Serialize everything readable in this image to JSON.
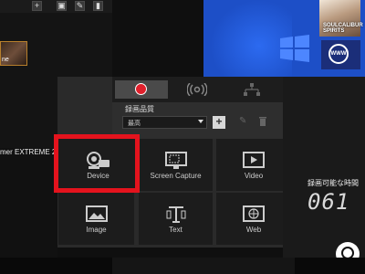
{
  "toolbar": {
    "add_label": "+",
    "icons": [
      "add-icon",
      "save-icon",
      "edit-icon",
      "delete-icon"
    ]
  },
  "source_panel": {
    "thumbnail_caption": "ne",
    "device_name_fragment": "mer EXTREME 2"
  },
  "preview": {
    "thumb1_text": "SOULCALIBUR SPIRITS",
    "thumb2_text": "WWW"
  },
  "record_panel": {
    "tabs": [
      {
        "name": "record",
        "icon": "record-icon"
      },
      {
        "name": "stream",
        "icon": "broadcast-icon"
      },
      {
        "name": "network",
        "icon": "network-icon"
      }
    ],
    "quality_label": "録画品質",
    "quality_value": "最高",
    "add_label": "+",
    "edit_label": "✎",
    "delete_label": "🗑"
  },
  "sources": {
    "device": "Device",
    "screen_capture": "Screen Capture",
    "video": "Video",
    "image": "Image",
    "text": "Text",
    "web": "Web"
  },
  "recording": {
    "time_label": "録画可能な時間",
    "time_digits": "061"
  },
  "colors": {
    "highlight": "#e4131d",
    "record_dot": "#e0202c",
    "desktop_blue": "#1d4fc7"
  }
}
